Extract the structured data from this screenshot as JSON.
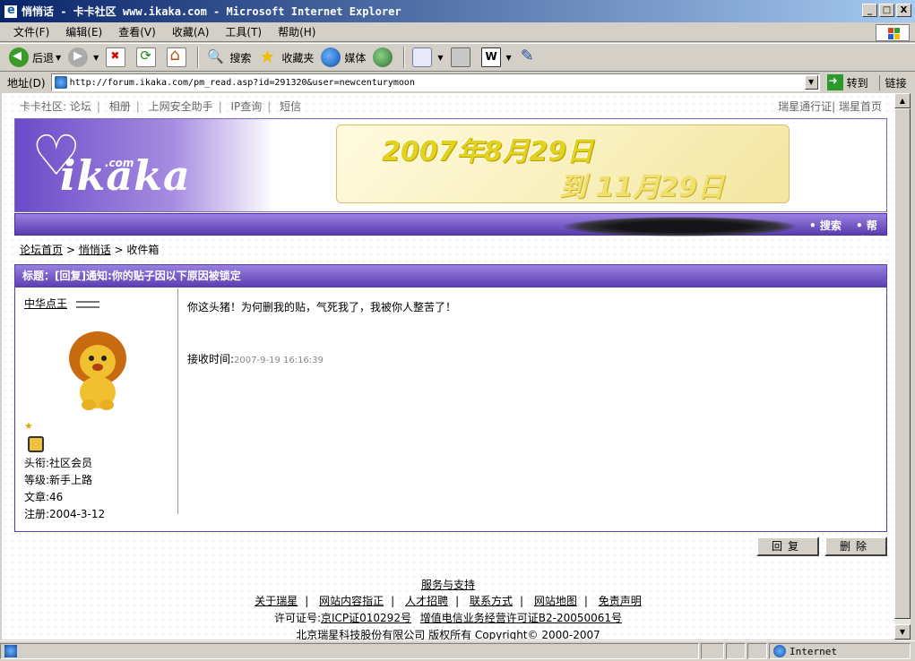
{
  "window": {
    "title": "悄悄话 - 卡卡社区 www.ikaka.com - Microsoft Internet Explorer",
    "minimize": "_",
    "maximize": "□",
    "close": "X"
  },
  "menu": [
    "文件(F)",
    "编辑(E)",
    "查看(V)",
    "收藏(A)",
    "工具(T)",
    "帮助(H)"
  ],
  "toolbar": {
    "back": "后退",
    "search": "搜索",
    "favorites": "收藏夹",
    "media": "媒体"
  },
  "address": {
    "label": "地址(D)",
    "url": "http://forum.ikaka.com/pm_read.asp?id=291320&user=newcenturymoon",
    "go": "转到",
    "links": "链接"
  },
  "topnav": {
    "left": [
      "卡卡社区: 论坛",
      "相册",
      "上网安全助手",
      "IP查询",
      "短信"
    ],
    "right": [
      "瑞星通行证",
      "瑞星首页"
    ]
  },
  "banner": {
    "logo_main": "ikaka",
    "logo_com": ".com",
    "promo_line1": "2007年8月29日",
    "promo_line2": "到 11月29日"
  },
  "navbar": {
    "search": "• 搜索",
    "help": "• 帮助"
  },
  "breadcrumb": {
    "home": "论坛首页",
    "pm": "悄悄话",
    "inbox": "收件箱"
  },
  "message": {
    "title": "标题：[回复]通知:你的贴子因以下原因被锁定",
    "body": "你这头猪！为何删我的贴，气死我了，我被你人整苦了！",
    "received_label": "接收时间:",
    "received_value": "2007-9-19 16:16:39"
  },
  "sender": {
    "name": "中华点王",
    "title": "头衔:社区会员",
    "level": "等级:新手上路",
    "posts": "文章:46",
    "registered": "注册:2004-3-12"
  },
  "buttons": {
    "reply": "回复",
    "delete": "删除"
  },
  "footer": {
    "heading": "服务与支持",
    "links": [
      "关于瑞星",
      "网站内容指正",
      "人才招聘",
      "联系方式",
      "网站地图",
      "免责声明"
    ],
    "license_label": "许可证号:",
    "license_icp": "京ICP证010292号",
    "license_value_added": "增值电信业务经营许可证B2-20050061号",
    "copyright": "北京瑞星科技股份有限公司  版权所有 Copyright© 2000-2007"
  },
  "status": {
    "zone": "Internet"
  }
}
